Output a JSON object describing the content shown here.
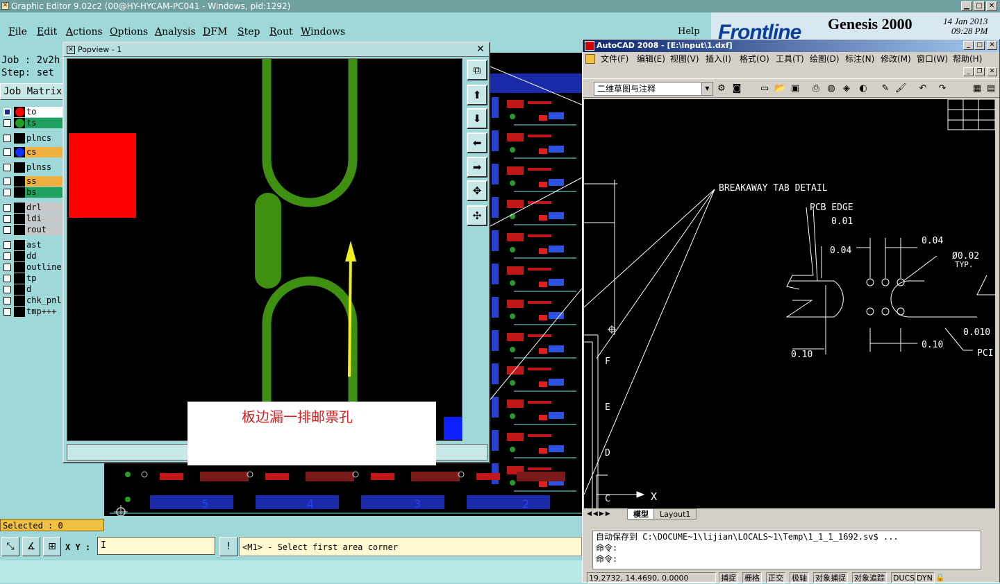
{
  "genesis": {
    "title": "Graphic Editor 9.02c2 (00@HY-HYCAM-PC041 - Windows, pid:1292)",
    "menu": [
      "File",
      "Edit",
      "Actions",
      "Options",
      "Analysis",
      "DFM",
      "Step",
      "Rout",
      "Windows"
    ],
    "help": "Help",
    "brand": "Frontline",
    "product": "Genesis 2000",
    "date": "14 Jan 2013",
    "time": "09:28 PM",
    "job": "Job : 2v2h",
    "step": "Step: set",
    "job_matrix": "Job Matrix",
    "layers": [
      {
        "name": "to",
        "color": "#ffffff",
        "dot": "#ff0000"
      },
      {
        "name": "ts",
        "color": "#20a060",
        "dot": "#20a020"
      },
      {
        "name": "plncs",
        "color": "#9fd8d8",
        "dot": ""
      },
      {
        "name": "cs",
        "color": "#f0b040",
        "dot": "#1030ff"
      },
      {
        "name": "plnss",
        "color": "#9fd8d8",
        "dot": ""
      },
      {
        "name": "ss",
        "color": "#f0b040",
        "dot": ""
      },
      {
        "name": "bs",
        "color": "#20a060",
        "dot": ""
      },
      {
        "name": "drl",
        "color": "#c8c8c8",
        "dot": ""
      },
      {
        "name": "ldi",
        "color": "#c8c8c8",
        "dot": ""
      },
      {
        "name": "rout",
        "color": "#c8c8c8",
        "dot": ""
      },
      {
        "name": "ast",
        "color": "#9fd8d8",
        "dot": ""
      },
      {
        "name": "dd",
        "color": "#9fd8d8",
        "dot": ""
      },
      {
        "name": "outline",
        "color": "#9fd8d8",
        "dot": ""
      },
      {
        "name": "tp",
        "color": "#9fd8d8",
        "dot": ""
      },
      {
        "name": "d",
        "color": "#9fd8d8",
        "dot": ""
      },
      {
        "name": "chk_pnl",
        "color": "#9fd8d8",
        "dot": ""
      },
      {
        "name": "tmp+++",
        "color": "#9fd8d8",
        "dot": ""
      }
    ],
    "selected": "Selected : 0",
    "xy_label": "X Y :",
    "xy_value": "I",
    "message": "<M1> - Select first area corner",
    "panel_numbers": [
      "5",
      "4",
      "3",
      "2"
    ]
  },
  "popview": {
    "title": "Popview - 1",
    "annotation": "板边漏一排邮票孔"
  },
  "autocad": {
    "title": "AutoCAD 2008 - [E:\\input\\1.dxf]",
    "menu": [
      "文件(F)",
      "编辑(E)",
      "视图(V)",
      "插入(I)",
      "格式(O)",
      "工具(T)",
      "绘图(D)",
      "标注(N)",
      "修改(M)",
      "窗口(W)",
      "帮助(H)"
    ],
    "workspace": "二维草图与注释",
    "drawing": {
      "detail_title": "BREAKAWAY TAB DETAIL",
      "pcb_edge": "PCB EDGE",
      "dim_001": "0.01",
      "dim_004a": "0.04",
      "dim_004b": "0.04",
      "hole": "Ø0.02",
      "typ": "TYP.",
      "dim_010a": "0.10",
      "dim_010b": "0.10",
      "dim_0010": "0.010",
      "pcb_cut": "PCI",
      "labels": [
        "F",
        "E",
        "D",
        "C"
      ],
      "axis_x": "X"
    },
    "tabs": [
      "模型",
      "Layout1"
    ],
    "cmd_lines": [
      "自动保存到 C:\\DOCUME~1\\lijian\\LOCALS~1\\Temp\\1_1_1_1692.sv$ ...",
      "命令:",
      "命令:"
    ],
    "coords": "19.2732, 14.4690, 0.0000",
    "status": [
      "捕捉",
      "栅格",
      "正交",
      "极轴",
      "对象捕捉",
      "对象追踪",
      "DUCS",
      "DYN"
    ]
  }
}
